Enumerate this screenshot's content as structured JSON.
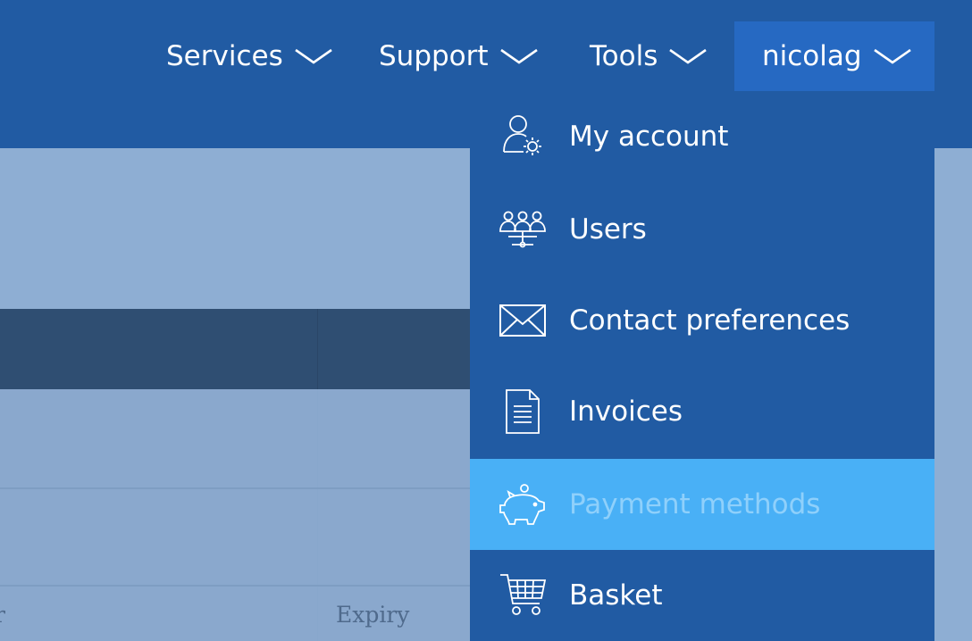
{
  "nav": {
    "services": "Services",
    "support": "Support",
    "tools": "Tools",
    "user": "nicolag"
  },
  "table": {
    "columns": [
      "r",
      "Expiry"
    ]
  },
  "menu": {
    "items": [
      {
        "label": "My account",
        "icon": "user-gear-icon"
      },
      {
        "label": "Users",
        "icon": "users-network-icon"
      },
      {
        "label": "Contact preferences",
        "icon": "envelope-icon"
      },
      {
        "label": "Invoices",
        "icon": "document-icon"
      },
      {
        "label": "Payment methods",
        "icon": "piggy-bank-icon",
        "active": true
      },
      {
        "label": "Basket",
        "icon": "cart-icon"
      }
    ]
  },
  "colors": {
    "nav_bg": "#215ba3",
    "user_tab_bg": "#2669c2",
    "active_item_bg": "#49b0f6",
    "overlay_bg": "#8eaed3"
  }
}
